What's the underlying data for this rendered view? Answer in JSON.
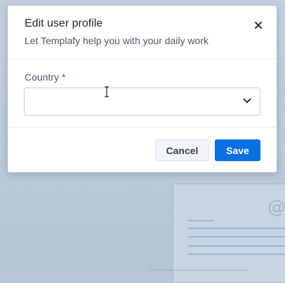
{
  "dialog": {
    "title": "Edit user profile",
    "subtitle": "Let Templafy help you with your daily work",
    "close_icon": "close-icon"
  },
  "form": {
    "country": {
      "label": "Country",
      "required_marker": "*",
      "value": "",
      "dropdown_icon": "chevron-down-icon"
    }
  },
  "footer": {
    "cancel_label": "Cancel",
    "save_label": "Save"
  },
  "background": {
    "card_symbol": "@"
  },
  "colors": {
    "primary": "#0a6fe0",
    "required": "#0a6fd6",
    "backdrop": "#b9c7d8"
  }
}
